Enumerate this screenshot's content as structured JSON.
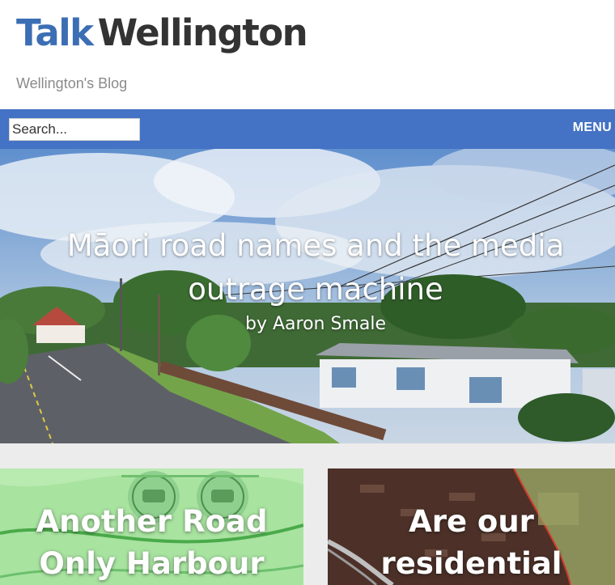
{
  "site": {
    "title_part1": "Talk",
    "title_part2": "Wellington",
    "tagline": "Wellington's Blog"
  },
  "nav": {
    "search_placeholder": "Search...",
    "menu_label": "MENU"
  },
  "hero": {
    "title": "Māori road names and the media outrage machine",
    "byline": "by  Aaron Smale"
  },
  "cards": [
    {
      "title": "Another Road Only Harbour"
    },
    {
      "title": "Are our residential"
    }
  ],
  "colors": {
    "brand_blue": "#3c6eb4",
    "nav_blue": "#4472c4",
    "title_dark": "#333333"
  }
}
